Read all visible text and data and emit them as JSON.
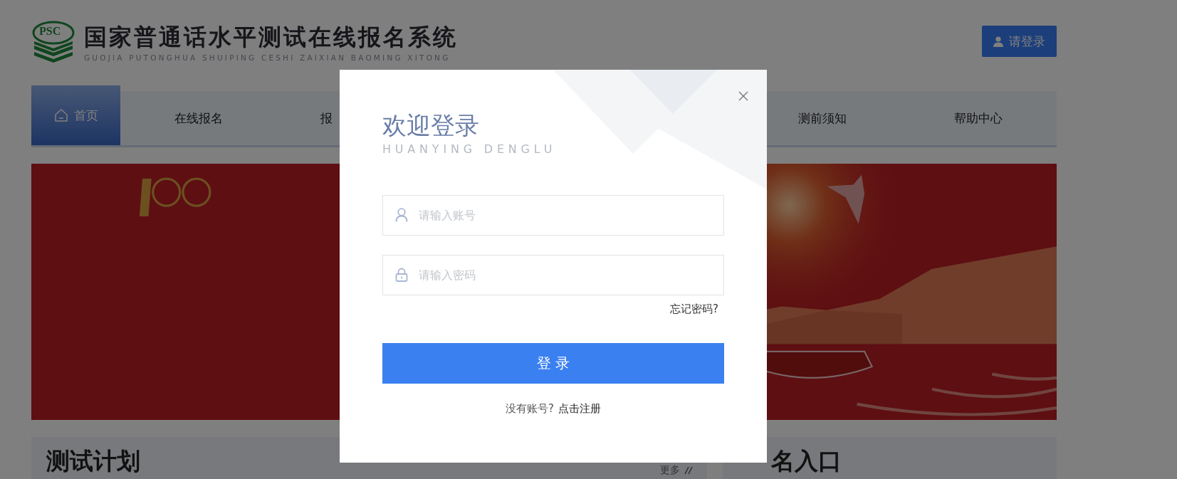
{
  "header": {
    "logo_text": "PSC",
    "title": "国家普通话水平测试在线报名系统",
    "subtitle": "GUOJIA PUTONGHUA SHUIPING CESHI ZAIXIAN BAOMING XITONG",
    "login_button": "请登录"
  },
  "nav": [
    {
      "label": "首页",
      "selected": true,
      "kind": "home"
    },
    {
      "label": "在线报名",
      "selected": false
    },
    {
      "label": "报",
      "selected": false
    },
    {
      "label": "测前须知",
      "selected": false
    },
    {
      "label": "帮助中心",
      "selected": false
    }
  ],
  "sections": [
    {
      "title": "测试计划",
      "more": "更多"
    },
    {
      "title": "名入口"
    }
  ],
  "login_dialog": {
    "title": "欢迎登录",
    "subtitle": "HUANYING DENGLU",
    "fields": [
      {
        "kind": "account",
        "placeholder": "请输入账号"
      },
      {
        "kind": "password",
        "placeholder": "请输入密码"
      }
    ],
    "forgot_link": "忘记密码?",
    "submit_button": "登 录",
    "register_prompt": "没有账号?",
    "register_link": "点击注册"
  }
}
